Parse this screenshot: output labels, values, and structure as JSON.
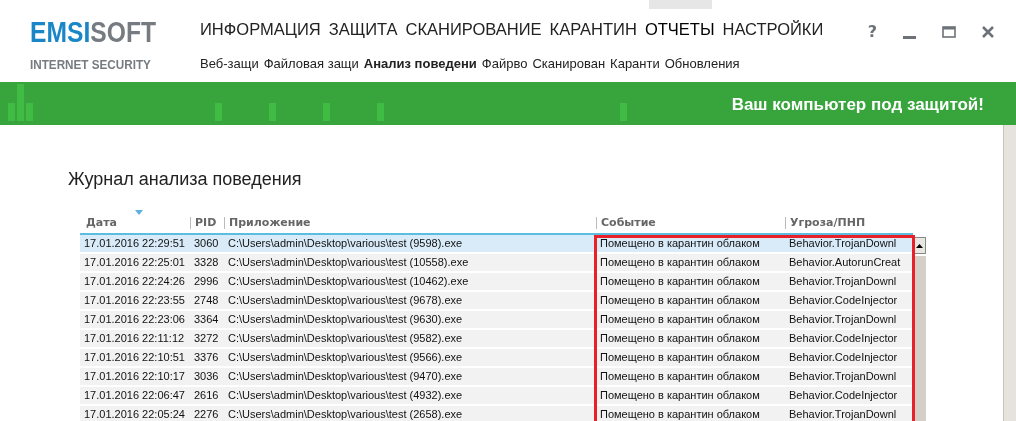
{
  "logo": {
    "brand_part1": "EMSI",
    "brand_part2": "SOFT",
    "product": "INTERNET SECURITY"
  },
  "main_nav": [
    {
      "label": "ИНФОРМАЦИЯ",
      "selected": false
    },
    {
      "label": "ЗАЩИТА",
      "selected": false
    },
    {
      "label": "СКАНИРОВАНИЕ",
      "selected": false
    },
    {
      "label": "КАРАНТИН",
      "selected": false
    },
    {
      "label": "ОТЧЕТЫ",
      "selected": true
    },
    {
      "label": "НАСТРОЙКИ",
      "selected": false
    }
  ],
  "sub_nav": [
    {
      "label": "Веб-защи",
      "selected": false
    },
    {
      "label": "Файловая защи",
      "selected": false
    },
    {
      "label": "Анализ поведени",
      "selected": true
    },
    {
      "label": "Файрво",
      "selected": false
    },
    {
      "label": "Сканирован",
      "selected": false
    },
    {
      "label": "Каранти",
      "selected": false
    },
    {
      "label": "Обновления",
      "selected": false
    }
  ],
  "window_controls": {
    "help": "?"
  },
  "status_banner": {
    "text": "Ваш компьютер под защитой!"
  },
  "section_title": "Журнал анализа поведения",
  "table": {
    "annotation": {
      "kind": "frame"
    },
    "columns": [
      {
        "label": "Дата",
        "sorted": true
      },
      {
        "label": "PID",
        "sorted": false
      },
      {
        "label": "Приложение",
        "sorted": false
      },
      {
        "label": "Событие",
        "sorted": false
      },
      {
        "label": "Угроза/ПНП",
        "sorted": false
      }
    ],
    "rows": [
      {
        "selected": true,
        "cells": [
          "17.01.2016 22:29:51",
          "3060",
          "C:\\Users\\admin\\Desktop\\various\\test (9598).exe",
          "Помещено в карантин облаком",
          "Behavior.TrojanDownl"
        ]
      },
      {
        "selected": false,
        "cells": [
          "17.01.2016 22:25:01",
          "3328",
          "C:\\Users\\admin\\Desktop\\various\\test (10558).exe",
          "Помещено в карантин облаком",
          "Behavior.AutorunCreat"
        ]
      },
      {
        "selected": false,
        "cells": [
          "17.01.2016 22:24:26",
          "2996",
          "C:\\Users\\admin\\Desktop\\various\\test (10462).exe",
          "Помещено в карантин облаком",
          "Behavior.TrojanDownl"
        ]
      },
      {
        "selected": false,
        "cells": [
          "17.01.2016 22:23:55",
          "2748",
          "C:\\Users\\admin\\Desktop\\various\\test (9678).exe",
          "Помещено в карантин облаком",
          "Behavior.CodeInjector"
        ]
      },
      {
        "selected": false,
        "cells": [
          "17.01.2016 22:23:06",
          "3364",
          "C:\\Users\\admin\\Desktop\\various\\test (9630).exe",
          "Помещено в карантин облаком",
          "Behavior.TrojanDownl"
        ]
      },
      {
        "selected": false,
        "cells": [
          "17.01.2016 22:11:12",
          "3272",
          "C:\\Users\\admin\\Desktop\\various\\test (9582).exe",
          "Помещено в карантин облаком",
          "Behavior.CodeInjector"
        ]
      },
      {
        "selected": false,
        "cells": [
          "17.01.2016 22:10:51",
          "3376",
          "C:\\Users\\admin\\Desktop\\various\\test (9566).exe",
          "Помещено в карантин облаком",
          "Behavior.CodeInjector"
        ]
      },
      {
        "selected": false,
        "cells": [
          "17.01.2016 22:10:17",
          "3036",
          "C:\\Users\\admin\\Desktop\\various\\test (9470).exe",
          "Помещено в карантин облаком",
          "Behavior.TrojanDownl"
        ]
      },
      {
        "selected": false,
        "cells": [
          "17.01.2016 22:06:47",
          "2616",
          "C:\\Users\\admin\\Desktop\\various\\test (4932).exe",
          "Помещено в карантин облаком",
          "Behavior.CodeInjector"
        ]
      },
      {
        "selected": false,
        "cells": [
          "17.01.2016 22:05:24",
          "2276",
          "C:\\Users\\admin\\Desktop\\various\\test (2658).exe",
          "Помещено в карантин облаком",
          "Behavior.TrojanDownl"
        ]
      }
    ]
  }
}
